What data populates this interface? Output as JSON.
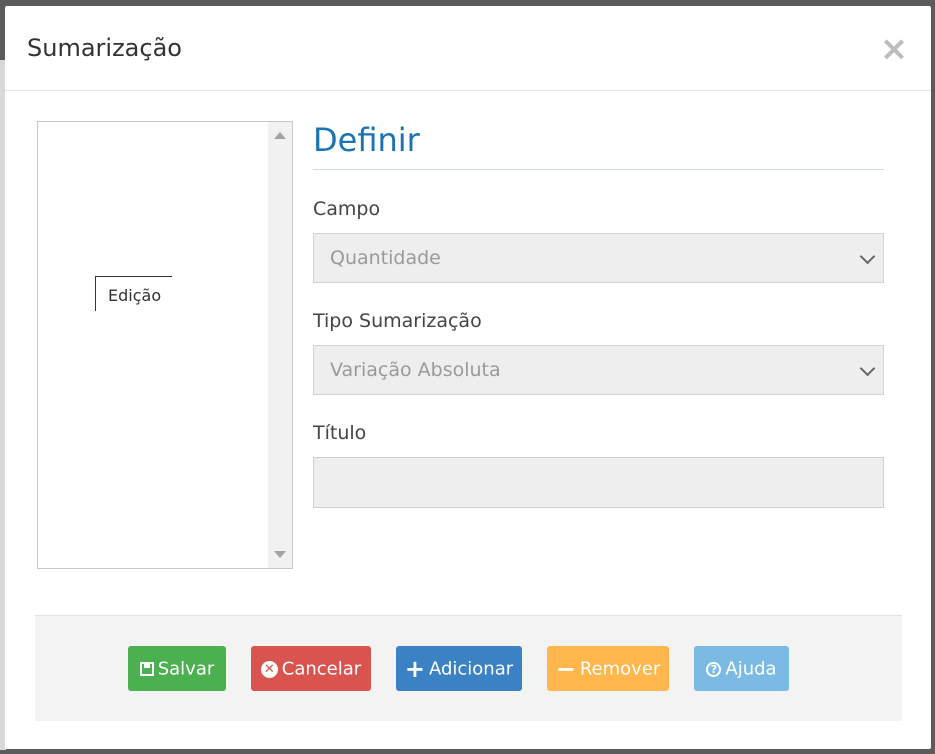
{
  "modal": {
    "title": "Sumarização",
    "close_glyph": "✕"
  },
  "tree": {
    "node_label": "Edição"
  },
  "form": {
    "section_title": "Definir",
    "campo_label": "Campo",
    "campo_value": "Quantidade",
    "tipo_label": "Tipo Sumarização",
    "tipo_value": "Variação Absoluta",
    "titulo_label": "Título",
    "titulo_value": ""
  },
  "buttons": {
    "save": "Salvar",
    "cancel": "Cancelar",
    "add": "Adicionar",
    "remove": "Remover",
    "help": "Ajuda"
  },
  "icons": {
    "save": "floppy-disk-icon",
    "cancel": "x-circle-icon",
    "add": "plus-icon",
    "remove": "minus-icon",
    "help": "question-circle-icon"
  },
  "colors": {
    "save": "#4caf50",
    "cancel": "#d9534f",
    "add": "#3b82c4",
    "remove": "#ffb74d",
    "help": "#7bbbe3",
    "title_accent": "#1a73b5"
  }
}
